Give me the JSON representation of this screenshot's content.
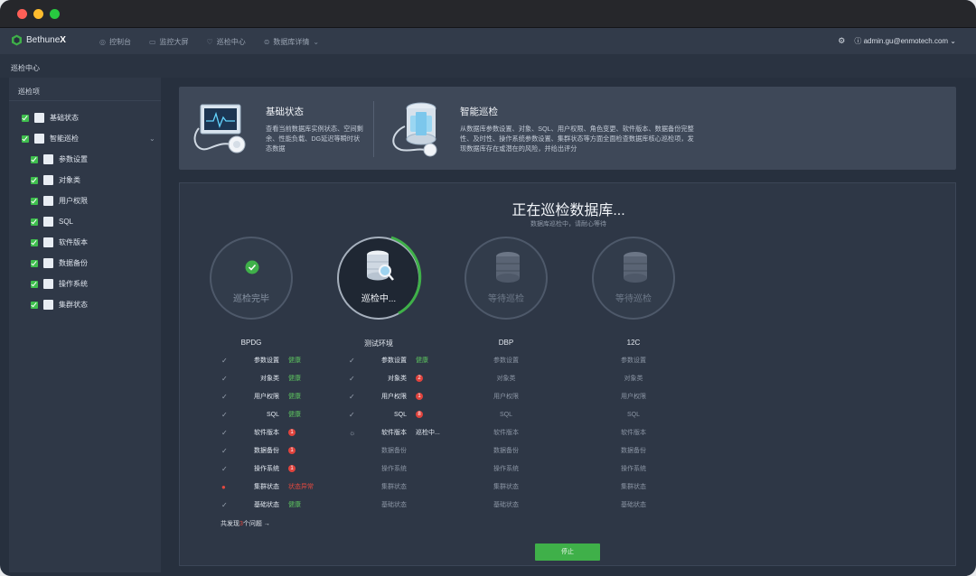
{
  "brand": {
    "name": "Bethune",
    "suffix": "X"
  },
  "nav": [
    "控制台",
    "监控大屏",
    "巡检中心",
    "数据库详情"
  ],
  "user": "admin.gu@enmotech.com",
  "breadcrumb": "巡检中心",
  "sidebar": {
    "header": "巡检项",
    "items": [
      "基础状态",
      "智能巡检",
      "参数设置",
      "对象类",
      "用户权限",
      "SQL",
      "软件版本",
      "数据备份",
      "操作系统",
      "集群状态"
    ]
  },
  "info": {
    "basic_title": "基础状态",
    "basic_desc_1": "查看当前数据库实例状态、空间剩",
    "basic_desc_2": "余、性能负载、DG延迟等瞬时状",
    "basic_desc_3": "态数据",
    "smart_title": "智能巡检",
    "smart_desc_1": "从数据库参数设置、对象、SQL、用户权限、角色变更、软件版本、数据备份完整",
    "smart_desc_2": "性、及时性、操作系统参数设置、集群状态等方面全面检查数据库核心巡检项，发",
    "smart_desc_3": "现数据库存在或潜在的风险，并给出评分"
  },
  "panel": {
    "title": "正在巡检数据库...",
    "subtitle": "数据库巡检中，请耐心等待"
  },
  "databases": [
    {
      "name": "BPDG",
      "state": "巡检完毕"
    },
    {
      "name": "测试环境",
      "state": "巡检中..."
    },
    {
      "name": "DBP",
      "state": "等待巡检"
    },
    {
      "name": "12C",
      "state": "等待巡检"
    }
  ],
  "check_labels": [
    "参数设置",
    "对象类",
    "用户权限",
    "SQL",
    "软件版本",
    "数据备份",
    "操作系统",
    "集群状态",
    "基础状态"
  ],
  "bpdg_results": [
    "健康",
    "健康",
    "健康",
    "健康",
    "1",
    "1",
    "1",
    "状态异常",
    "健康"
  ],
  "test_results": [
    "健康",
    "2",
    "1",
    "8",
    "巡检中..."
  ],
  "summary": {
    "prefix": "共发现",
    "count": "3",
    "suffix": "个问题 →"
  },
  "stop_label": "停止",
  "colors": {
    "accent": "#3fb049",
    "error": "#e2483f",
    "ok": "#5cc15f",
    "bg": "#27303e"
  }
}
